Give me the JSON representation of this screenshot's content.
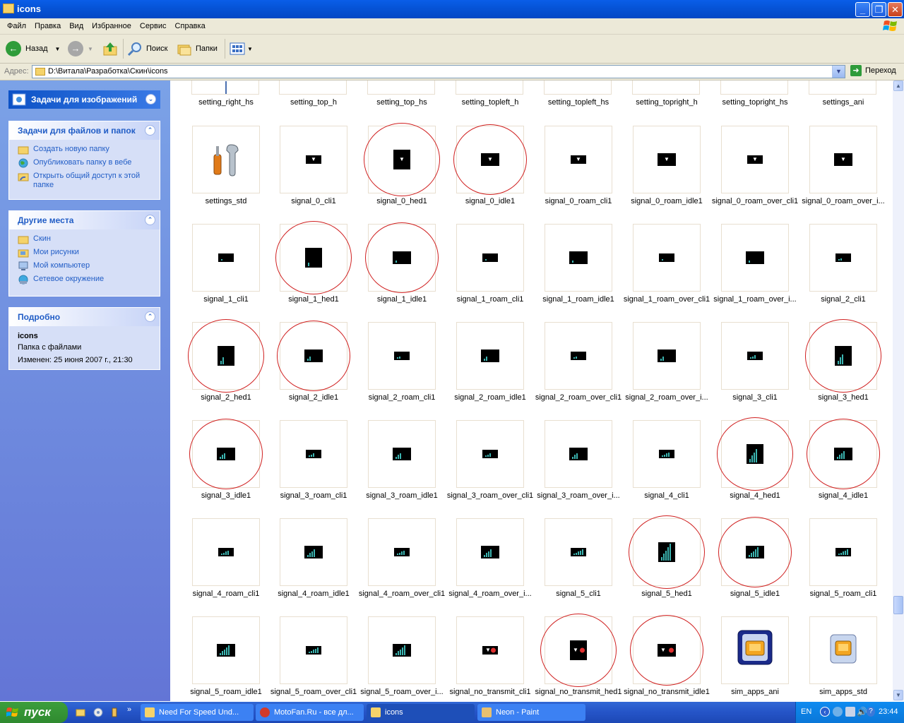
{
  "window": {
    "title": "icons"
  },
  "menu": [
    "Файл",
    "Правка",
    "Вид",
    "Избранное",
    "Сервис",
    "Справка"
  ],
  "toolbar": {
    "back": "Назад",
    "search": "Поиск",
    "folders": "Папки"
  },
  "address": {
    "label": "Адрес:",
    "value": "D:\\Витала\\Разработка\\Скин\\icons",
    "go": "Переход"
  },
  "left": {
    "special_title": "Задачи для изображений",
    "file_tasks": {
      "title": "Задачи для файлов и папок",
      "items": [
        "Создать новую папку",
        "Опубликовать папку в вебе",
        "Открыть общий доступ к этой папке"
      ]
    },
    "other_places": {
      "title": "Другие места",
      "items": [
        "Скин",
        "Мои рисунки",
        "Мой компьютер",
        "Сетевое окружение"
      ]
    },
    "details": {
      "title": "Подробно",
      "name": "icons",
      "type": "Папка с файлами",
      "modified": "Изменен: 25 июня 2007 г., 21:30"
    }
  },
  "top_row": [
    "setting_right_hs",
    "setting_top_h",
    "setting_top_hs",
    "setting_topleft_h",
    "setting_topleft_hs",
    "setting_topright_h",
    "setting_topright_hs",
    "settings_ani"
  ],
  "rows": [
    [
      {
        "name": "settings_std",
        "icon": "tools",
        "circled": false
      },
      {
        "name": "signal_0_cli1",
        "icon": "sig",
        "bars": 0,
        "size": "s",
        "circled": false
      },
      {
        "name": "signal_0_hed1",
        "icon": "sig",
        "bars": 0,
        "size": "t",
        "circled": true
      },
      {
        "name": "signal_0_idle1",
        "icon": "sig",
        "bars": 0,
        "size": "l",
        "circled": true
      },
      {
        "name": "signal_0_roam_cli1",
        "icon": "sig",
        "bars": 0,
        "size": "s",
        "circled": false
      },
      {
        "name": "signal_0_roam_idle1",
        "icon": "sig",
        "bars": 0,
        "size": "l",
        "circled": false
      },
      {
        "name": "signal_0_roam_over_cli1",
        "icon": "sig",
        "bars": 0,
        "size": "s",
        "circled": false
      },
      {
        "name": "signal_0_roam_over_i...",
        "icon": "sig",
        "bars": 0,
        "size": "l",
        "circled": false
      }
    ],
    [
      {
        "name": "signal_1_cli1",
        "icon": "sig",
        "bars": 1,
        "size": "s",
        "circled": false
      },
      {
        "name": "signal_1_hed1",
        "icon": "sig",
        "bars": 1,
        "size": "t",
        "circled": true
      },
      {
        "name": "signal_1_idle1",
        "icon": "sig",
        "bars": 1,
        "size": "l",
        "circled": true
      },
      {
        "name": "signal_1_roam_cli1",
        "icon": "sig",
        "bars": 1,
        "size": "s",
        "circled": false
      },
      {
        "name": "signal_1_roam_idle1",
        "icon": "sig",
        "bars": 1,
        "size": "l",
        "circled": false
      },
      {
        "name": "signal_1_roam_over_cli1",
        "icon": "sig",
        "bars": 1,
        "size": "s",
        "circled": false
      },
      {
        "name": "signal_1_roam_over_i...",
        "icon": "sig",
        "bars": 1,
        "size": "l",
        "circled": false
      },
      {
        "name": "signal_2_cli1",
        "icon": "sig",
        "bars": 2,
        "size": "s",
        "circled": false
      }
    ],
    [
      {
        "name": "signal_2_hed1",
        "icon": "sig",
        "bars": 2,
        "size": "t",
        "circled": true
      },
      {
        "name": "signal_2_idle1",
        "icon": "sig",
        "bars": 2,
        "size": "l",
        "circled": true
      },
      {
        "name": "signal_2_roam_cli1",
        "icon": "sig",
        "bars": 2,
        "size": "s",
        "circled": false
      },
      {
        "name": "signal_2_roam_idle1",
        "icon": "sig",
        "bars": 2,
        "size": "l",
        "circled": false
      },
      {
        "name": "signal_2_roam_over_cli1",
        "icon": "sig",
        "bars": 2,
        "size": "s",
        "circled": false
      },
      {
        "name": "signal_2_roam_over_i...",
        "icon": "sig",
        "bars": 2,
        "size": "l",
        "circled": false
      },
      {
        "name": "signal_3_cli1",
        "icon": "sig",
        "bars": 3,
        "size": "s",
        "circled": false
      },
      {
        "name": "signal_3_hed1",
        "icon": "sig",
        "bars": 3,
        "size": "t",
        "circled": true
      }
    ],
    [
      {
        "name": "signal_3_idle1",
        "icon": "sig",
        "bars": 3,
        "size": "l",
        "circled": true
      },
      {
        "name": "signal_3_roam_cli1",
        "icon": "sig",
        "bars": 3,
        "size": "s",
        "circled": false
      },
      {
        "name": "signal_3_roam_idle1",
        "icon": "sig",
        "bars": 3,
        "size": "l",
        "circled": false
      },
      {
        "name": "signal_3_roam_over_cli1",
        "icon": "sig",
        "bars": 3,
        "size": "s",
        "circled": false
      },
      {
        "name": "signal_3_roam_over_i...",
        "icon": "sig",
        "bars": 3,
        "size": "l",
        "circled": false
      },
      {
        "name": "signal_4_cli1",
        "icon": "sig",
        "bars": 4,
        "size": "s",
        "circled": false
      },
      {
        "name": "signal_4_hed1",
        "icon": "sig",
        "bars": 4,
        "size": "t",
        "circled": true
      },
      {
        "name": "signal_4_idle1",
        "icon": "sig",
        "bars": 4,
        "size": "l",
        "circled": true
      }
    ],
    [
      {
        "name": "signal_4_roam_cli1",
        "icon": "sig",
        "bars": 4,
        "size": "s",
        "circled": false
      },
      {
        "name": "signal_4_roam_idle1",
        "icon": "sig",
        "bars": 4,
        "size": "l",
        "circled": false
      },
      {
        "name": "signal_4_roam_over_cli1",
        "icon": "sig",
        "bars": 4,
        "size": "s",
        "circled": false
      },
      {
        "name": "signal_4_roam_over_i...",
        "icon": "sig",
        "bars": 4,
        "size": "l",
        "circled": false
      },
      {
        "name": "signal_5_cli1",
        "icon": "sig",
        "bars": 5,
        "size": "s",
        "circled": false
      },
      {
        "name": "signal_5_hed1",
        "icon": "sig",
        "bars": 5,
        "size": "t",
        "circled": true
      },
      {
        "name": "signal_5_idle1",
        "icon": "sig",
        "bars": 5,
        "size": "l",
        "circled": true
      },
      {
        "name": "signal_5_roam_cli1",
        "icon": "sig",
        "bars": 5,
        "size": "s",
        "circled": false
      }
    ],
    [
      {
        "name": "signal_5_roam_idle1",
        "icon": "sig",
        "bars": 5,
        "size": "l",
        "circled": false
      },
      {
        "name": "signal_5_roam_over_cli1",
        "icon": "sig",
        "bars": 5,
        "size": "s",
        "circled": false
      },
      {
        "name": "signal_5_roam_over_i...",
        "icon": "sig",
        "bars": 5,
        "size": "l",
        "circled": false
      },
      {
        "name": "signal_no_transmit_cli1",
        "icon": "sig",
        "bars": -1,
        "size": "s",
        "circled": false
      },
      {
        "name": "signal_no_transmit_hed1",
        "icon": "sig",
        "bars": -1,
        "size": "t",
        "circled": true
      },
      {
        "name": "signal_no_transmit_idle1",
        "icon": "sig",
        "bars": -1,
        "size": "l",
        "circled": true
      },
      {
        "name": "sim_apps_ani",
        "icon": "sim-ani",
        "circled": false
      },
      {
        "name": "sim_apps_std",
        "icon": "sim-std",
        "circled": false
      }
    ]
  ],
  "taskbar": {
    "start": "пуск",
    "tasks": [
      "Need For Speed Und...",
      "MotoFan.Ru - все дл...",
      "icons",
      "Neon - Paint"
    ],
    "lang": "EN",
    "clock": "23:44"
  }
}
